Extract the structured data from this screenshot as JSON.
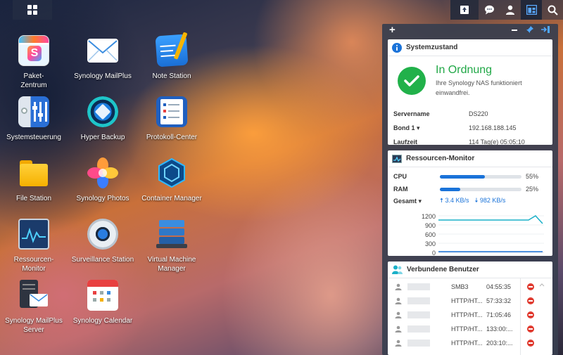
{
  "desktop": {
    "icons": [
      {
        "label": "Paket-\nZentrum"
      },
      {
        "label": "Synology MailPlus"
      },
      {
        "label": "Note Station"
      },
      {
        "label": "Systemsteuerung"
      },
      {
        "label": "Hyper Backup"
      },
      {
        "label": "Protokoll-Center"
      },
      {
        "label": "File Station"
      },
      {
        "label": "Synology Photos"
      },
      {
        "label": "Container Manager"
      },
      {
        "label": "Ressourcen-\nMonitor"
      },
      {
        "label": "Surveillance Station"
      },
      {
        "label": "Virtual Machine\nManager"
      },
      {
        "label": "Synology MailPlus\nServer"
      },
      {
        "label": "Synology Calendar"
      }
    ]
  },
  "panel": {
    "add": "+",
    "system": {
      "title": "Systemzustand",
      "status": "In Ordnung",
      "message": "Ihre Synology NAS funktioniert einwandfrei.",
      "rows": [
        {
          "key": "Servername",
          "value": "DS220"
        },
        {
          "key": "Bond 1 ▾",
          "value": "192.168.188.145"
        },
        {
          "key": "Laufzeit",
          "value": "114 Tag(e) 05:05:10"
        }
      ]
    },
    "resources": {
      "title": "Ressourcen-Monitor",
      "cpu_label": "CPU",
      "cpu_pct": "55%",
      "cpu_value": 55,
      "ram_label": "RAM",
      "ram_pct": "25%",
      "ram_value": 25,
      "net_label": "Gesamt ▾",
      "upload": "3.4 KB/s",
      "download": "982 KB/s",
      "y_ticks": [
        "1200",
        "900",
        "600",
        "300",
        "0"
      ]
    },
    "users": {
      "title": "Verbundene Benutzer",
      "rows": [
        {
          "protocol": "SMB3",
          "time": "04:55:35"
        },
        {
          "protocol": "HTTP/HT...",
          "time": "57:33:32"
        },
        {
          "protocol": "HTTP/HT...",
          "time": "71:05:46"
        },
        {
          "protocol": "HTTP/HT...",
          "time": "133:00:..."
        },
        {
          "protocol": "HTTP/HT...",
          "time": "203:10:..."
        }
      ]
    }
  },
  "colors": {
    "accent": "#1a73d9",
    "ok": "#21b14a",
    "danger": "#e03a2f"
  }
}
